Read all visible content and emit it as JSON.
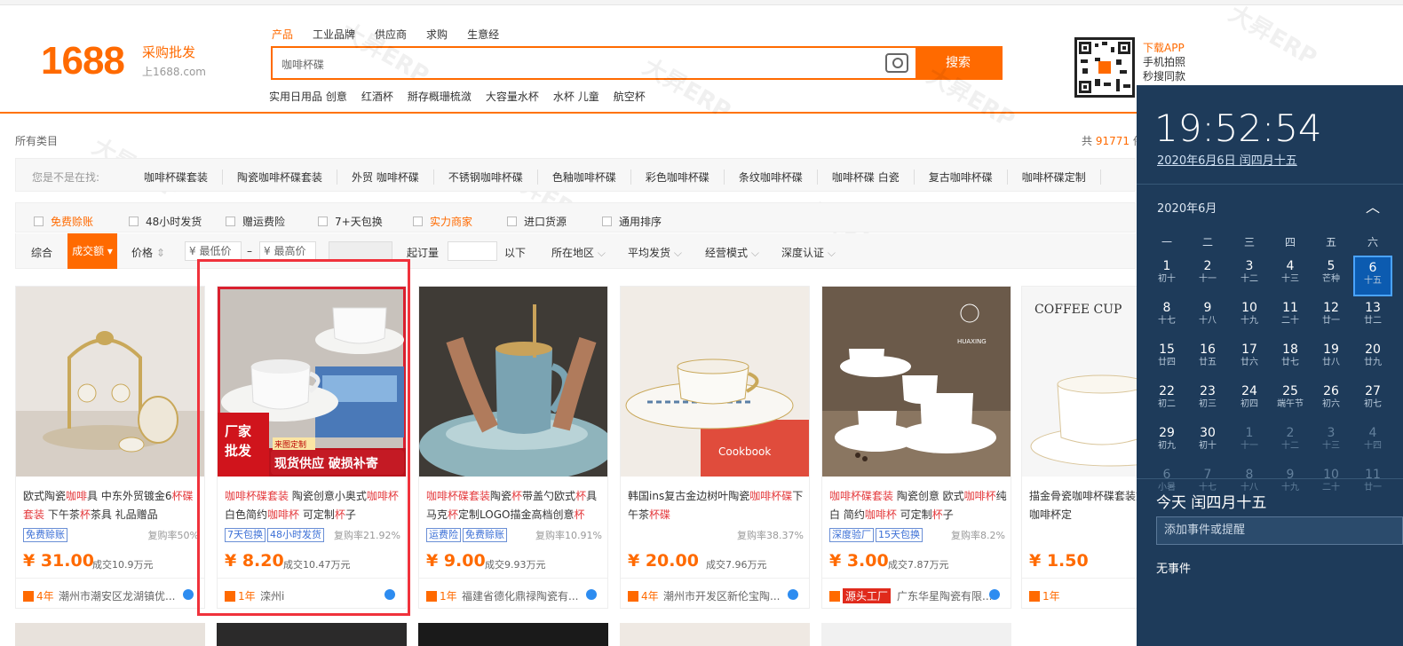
{
  "header": {
    "logo": "1688",
    "logo_slogan": "采购批发",
    "logo_domain": "上1688.com",
    "tabs": [
      "产品",
      "工业品牌",
      "供应商",
      "求购",
      "生意经"
    ],
    "search_value": "咖啡杯碟",
    "search_button": "搜索",
    "hotwords": [
      "实用日用品 创意",
      "红酒杯",
      "掰存概珊梳潋",
      "大容量水杯",
      "水杯 儿童",
      "航空杯"
    ],
    "app_lines": [
      "下载APP",
      "手机拍照",
      "秒搜同款"
    ]
  },
  "category": {
    "all": "所有类目",
    "total_prefix": "共",
    "total_count": "91771",
    "total_suffix": "件"
  },
  "did_you_mean": {
    "label": "您是不是在找:",
    "items": [
      "咖啡杯碟套装",
      "陶瓷咖啡杯碟套装",
      "外贸 咖啡杯碟",
      "不锈钢咖啡杯碟",
      "色釉咖啡杯碟",
      "彩色咖啡杯碟",
      "条纹咖啡杯碟",
      "咖啡杯碟 白瓷",
      "复古咖啡杯碟",
      "咖啡杯碟定制"
    ]
  },
  "filters": [
    {
      "label": "免费赊账",
      "highlight": true
    },
    {
      "label": "48小时发货",
      "highlight": false
    },
    {
      "label": "赠运费险",
      "highlight": false
    },
    {
      "label": "7+天包换",
      "highlight": false
    },
    {
      "label": "实力商家",
      "highlight": true
    },
    {
      "label": "进口货源",
      "highlight": false
    },
    {
      "label": "通用排序",
      "highlight": false
    }
  ],
  "sortbar": {
    "overall": "综合",
    "volume": "成交额",
    "price": "价格",
    "min_price": "¥ 最低价",
    "dash": "–",
    "max_price": "¥ 最高价",
    "moq": "起订量",
    "below": "以下",
    "region": "所在地区",
    "avg_ship": "平均发货",
    "mode": "经营模式",
    "cert": "深度认证"
  },
  "products": [
    {
      "title_parts": [
        [
          "欧式陶瓷",
          false
        ],
        [
          "咖啡",
          true
        ],
        [
          "具 中东外贸镀金6",
          false
        ],
        [
          "杯碟",
          true
        ],
        [
          "套装",
          true
        ],
        [
          " 下午茶",
          false
        ],
        [
          "杯",
          true
        ],
        [
          "茶具 礼品赠品",
          false
        ]
      ],
      "tags": [
        "免费赊账"
      ],
      "repurchase": "复购率50%",
      "price": "¥ 31.00",
      "deal": "成交10.9万元",
      "years": "4年",
      "location": "潮州市潮安区龙湖镇优..."
    },
    {
      "title_parts": [
        [
          "咖啡杯碟套装",
          true
        ],
        [
          " 陶瓷创意小奥式",
          false
        ],
        [
          "咖啡杯",
          true
        ],
        [
          "白色简约",
          false
        ],
        [
          "咖啡杯",
          true
        ],
        [
          " 可定制",
          false
        ],
        [
          "杯",
          true
        ],
        [
          "子",
          false
        ]
      ],
      "tags": [
        "7天包换",
        "48小时发货"
      ],
      "repurchase": "复购率21.92%",
      "price": "¥ 8.20",
      "deal": "成交10.47万元",
      "years": "1年",
      "location": "滦州i"
    },
    {
      "title_parts": [
        [
          "咖啡杯碟套装",
          true
        ],
        [
          "陶瓷",
          false
        ],
        [
          "杯",
          true
        ],
        [
          "带盖勺欧式",
          false
        ],
        [
          "杯",
          true
        ],
        [
          "具",
          false
        ],
        [
          "马克",
          false
        ],
        [
          "杯",
          true
        ],
        [
          "定制LOGO描金高档创意",
          false
        ],
        [
          "杯",
          true
        ]
      ],
      "tags": [
        "运费险",
        "免费赊账"
      ],
      "repurchase": "复购率10.91%",
      "price": "¥ 9.00",
      "deal": "成交9.93万元",
      "years": "1年",
      "location": "福建省德化鼎禄陶瓷有..."
    },
    {
      "title_parts": [
        [
          "韩国ins复古金边树叶陶瓷",
          false
        ],
        [
          "咖啡杯碟",
          true
        ],
        [
          "下午茶",
          false
        ],
        [
          "杯碟",
          true
        ]
      ],
      "tags": [],
      "repurchase": "复购率38.37%",
      "price": "¥ 20.00",
      "deal": "成交7.96万元",
      "years": "4年",
      "location": "潮州市开发区新伦宝陶..."
    },
    {
      "title_parts": [
        [
          "咖啡杯碟套装",
          true
        ],
        [
          " 陶瓷创意 欧式",
          false
        ],
        [
          "咖啡杯",
          true
        ],
        [
          "纯白 简约",
          false
        ],
        [
          "咖啡杯",
          true
        ],
        [
          " 可定制",
          false
        ],
        [
          "杯",
          true
        ],
        [
          "子",
          false
        ]
      ],
      "tags": [
        "深度验厂",
        "15天包换"
      ],
      "repurchase": "复购率8.2%",
      "price": "¥ 3.00",
      "deal": "成交7.87万元",
      "years": "源头工厂",
      "location": "广东华星陶瓷有限..."
    },
    {
      "title_parts": [
        [
          "描金骨瓷咖啡杯碟套装",
          false
        ],
        [
          "式下午茶陶瓷咖啡杯定",
          false
        ]
      ],
      "tags": [],
      "repurchase": "",
      "price": "¥ 1.50",
      "deal": "",
      "years": "1年",
      "location": ""
    }
  ],
  "product_image_texts": {
    "badge_top": "来图定制",
    "badge_left1": "厂家",
    "badge_left2": "批发",
    "badge_main": "现货供应 破损补寄",
    "coffee_cup": "COFFEE CUP",
    "huaxing": "HUAXING"
  },
  "calendar": {
    "time": "19:52:54",
    "date": "2020年6月6日 闰四月十五",
    "month": "2020年6月",
    "weekdays": [
      "一",
      "二",
      "三",
      "四",
      "五",
      "六"
    ],
    "weeks": [
      [
        [
          "1",
          "初十"
        ],
        [
          "2",
          "十一"
        ],
        [
          "3",
          "十二"
        ],
        [
          "4",
          "十三"
        ],
        [
          "5",
          "芒种"
        ],
        [
          "6",
          "十五"
        ]
      ],
      [
        [
          "8",
          "十七"
        ],
        [
          "9",
          "十八"
        ],
        [
          "10",
          "十九"
        ],
        [
          "11",
          "二十"
        ],
        [
          "12",
          "廿一"
        ],
        [
          "13",
          "廿二"
        ]
      ],
      [
        [
          "15",
          "廿四"
        ],
        [
          "16",
          "廿五"
        ],
        [
          "17",
          "廿六"
        ],
        [
          "18",
          "廿七"
        ],
        [
          "19",
          "廿八"
        ],
        [
          "20",
          "廿九"
        ]
      ],
      [
        [
          "22",
          "初二"
        ],
        [
          "23",
          "初三"
        ],
        [
          "24",
          "初四"
        ],
        [
          "25",
          "端午节"
        ],
        [
          "26",
          "初六"
        ],
        [
          "27",
          "初七"
        ]
      ],
      [
        [
          "29",
          "初九"
        ],
        [
          "30",
          "初十"
        ],
        [
          "1",
          "十一"
        ],
        [
          "2",
          "十二"
        ],
        [
          "3",
          "十三"
        ],
        [
          "4",
          "十四"
        ]
      ],
      [
        [
          "6",
          "小暑"
        ],
        [
          "7",
          "十七"
        ],
        [
          "8",
          "十八"
        ],
        [
          "9",
          "十九"
        ],
        [
          "10",
          "二十"
        ],
        [
          "11",
          "廿一"
        ]
      ]
    ],
    "today": "今天 闰四月十五",
    "add_event_placeholder": "添加事件或提醒",
    "no_events": "无事件"
  },
  "watermark": "大昇ERP"
}
